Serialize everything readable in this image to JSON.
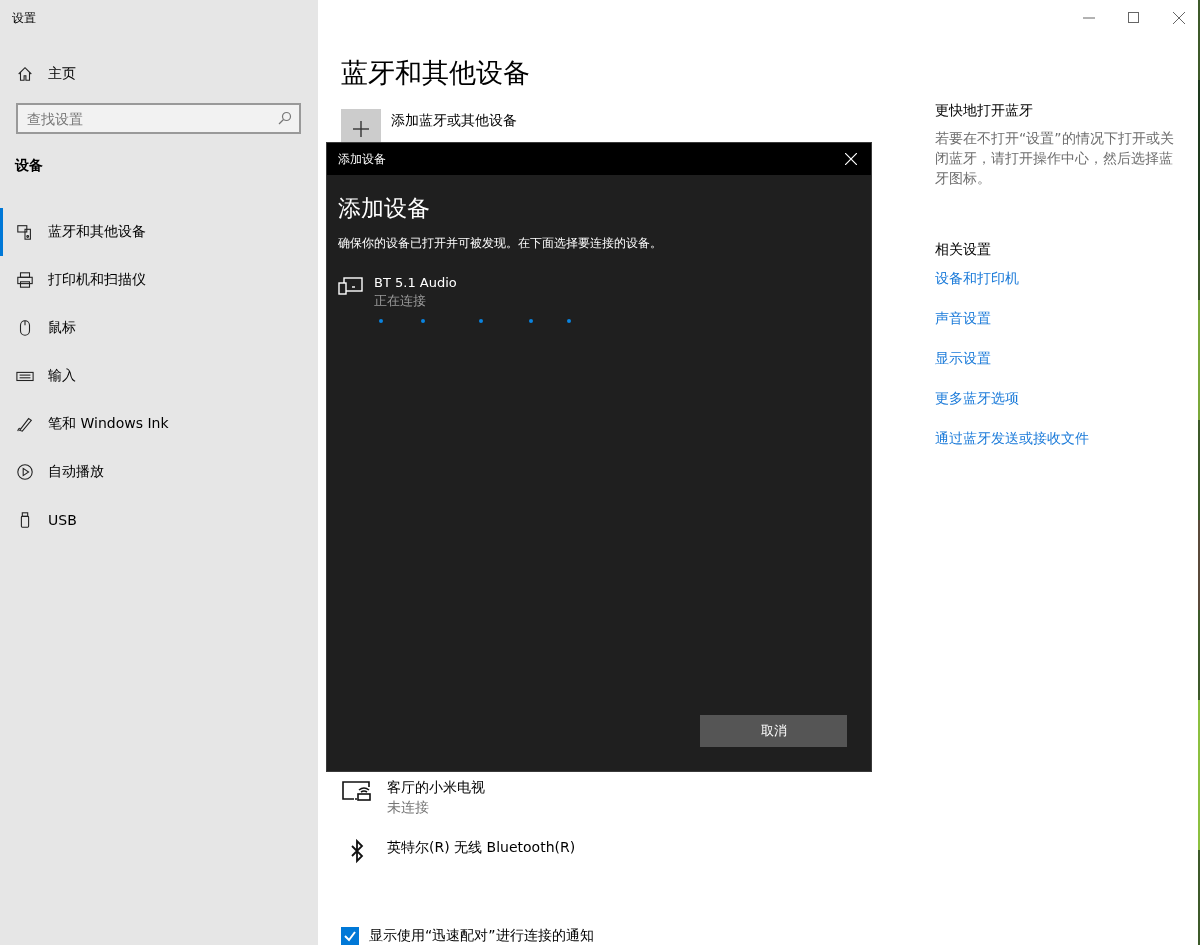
{
  "window": {
    "title": "设置"
  },
  "sidebar": {
    "home": "主页",
    "search": {
      "placeholder": "查找设置"
    },
    "section": "设备",
    "items": [
      {
        "label": "蓝牙和其他设备",
        "selected": true
      },
      {
        "label": "打印机和扫描仪",
        "selected": false
      },
      {
        "label": "鼠标",
        "selected": false
      },
      {
        "label": "输入",
        "selected": false
      },
      {
        "label": "笔和 Windows Ink",
        "selected": false
      },
      {
        "label": "自动播放",
        "selected": false
      },
      {
        "label": "USB",
        "selected": false
      }
    ]
  },
  "main": {
    "title": "蓝牙和其他设备",
    "add_button": "添加蓝牙或其他设备",
    "devices": [
      {
        "name": "客厅的小米电视",
        "status": "未连接"
      },
      {
        "name": "英特尔(R) 无线 Bluetooth(R)"
      }
    ],
    "notification_checkbox": {
      "label": "显示使用“迅速配对”进行连接的通知",
      "checked": true
    }
  },
  "aside": {
    "heading": "更快地打开蓝牙",
    "text": "若要在不打开“设置”的情况下打开或关闭蓝牙，请打开操作中心，然后选择蓝牙图标。",
    "related_heading": "相关设置",
    "links": [
      "设备和打印机",
      "声音设置",
      "显示设置",
      "更多蓝牙选项",
      "通过蓝牙发送或接收文件"
    ]
  },
  "dialog": {
    "title": "添加设备",
    "heading": "添加设备",
    "instructions": "确保你的设备已打开并可被发现。在下面选择要连接的设备。",
    "devices": [
      {
        "name": "BT 5.1 Audio",
        "status": "正在连接"
      }
    ],
    "cancel": "取消"
  }
}
